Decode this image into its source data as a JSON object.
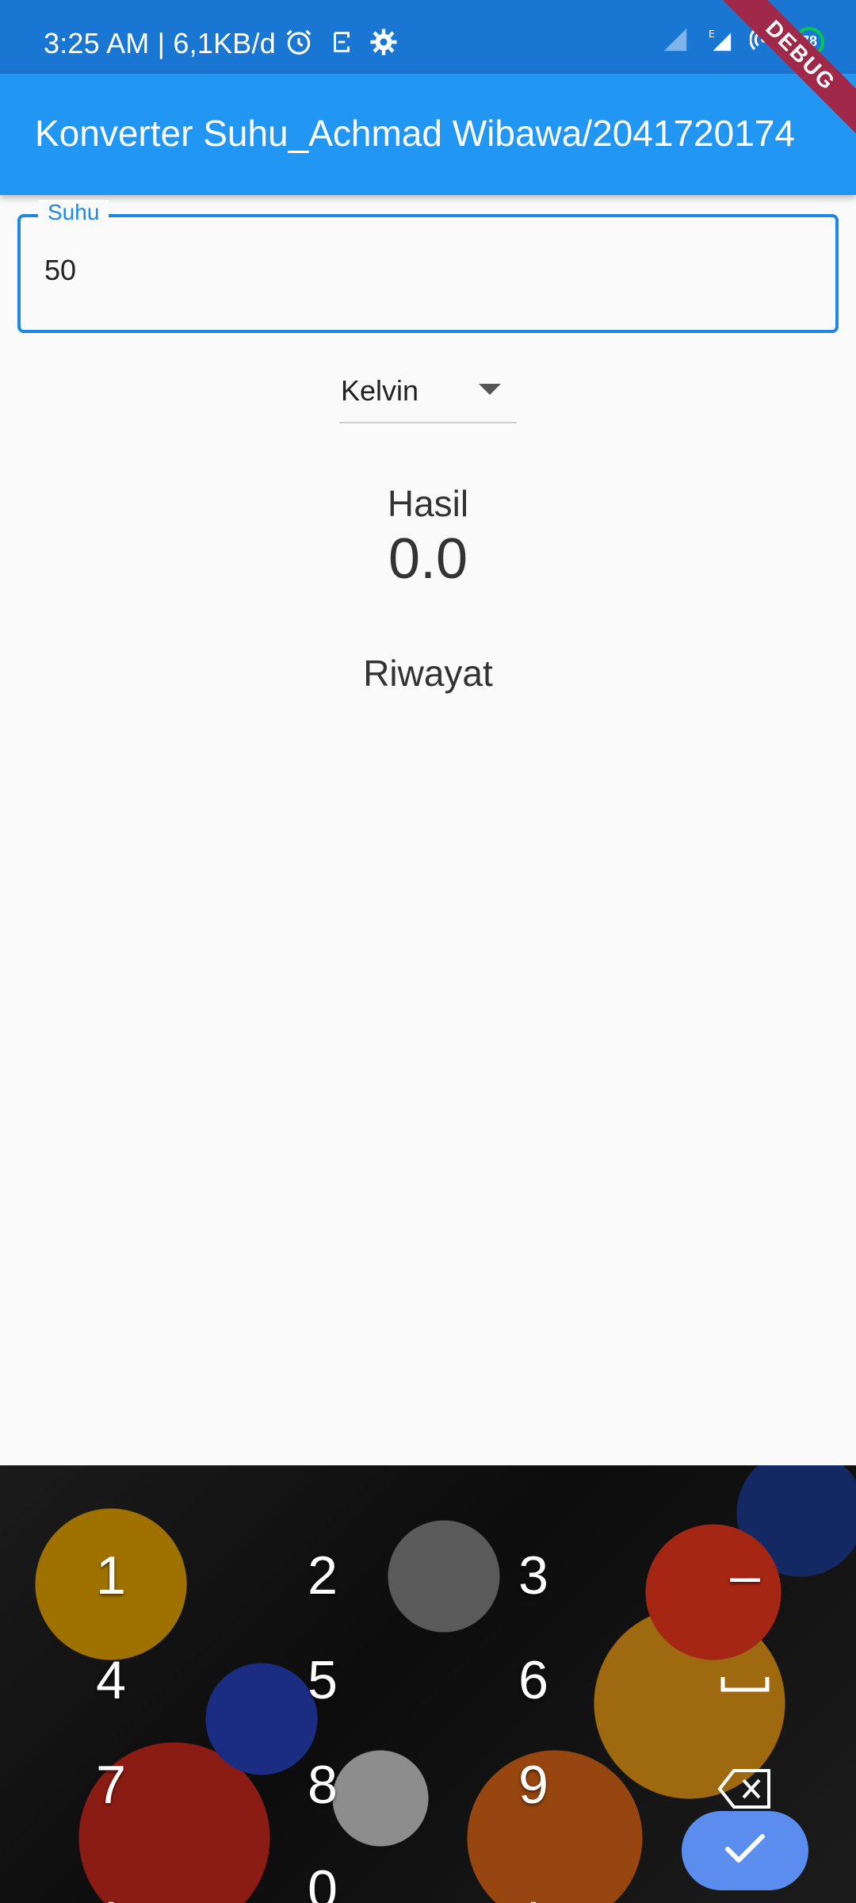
{
  "status_bar": {
    "time_text": "3:25 AM | 6,1KB/d",
    "battery_level": "78"
  },
  "app_bar": {
    "title": "Konverter Suhu_Achmad Wibawa/2041720174"
  },
  "debug_banner": "DEBUG",
  "temperature_field": {
    "label": "Suhu",
    "value": "50"
  },
  "unit_dropdown": {
    "selected": "Kelvin"
  },
  "result": {
    "label": "Hasil",
    "value": "0.0"
  },
  "history": {
    "label": "Riwayat"
  },
  "keyboard": {
    "keys": [
      "1",
      "2",
      "3",
      "–",
      "4",
      "5",
      "6",
      "7",
      "8",
      "9",
      ",",
      "0",
      "."
    ]
  }
}
